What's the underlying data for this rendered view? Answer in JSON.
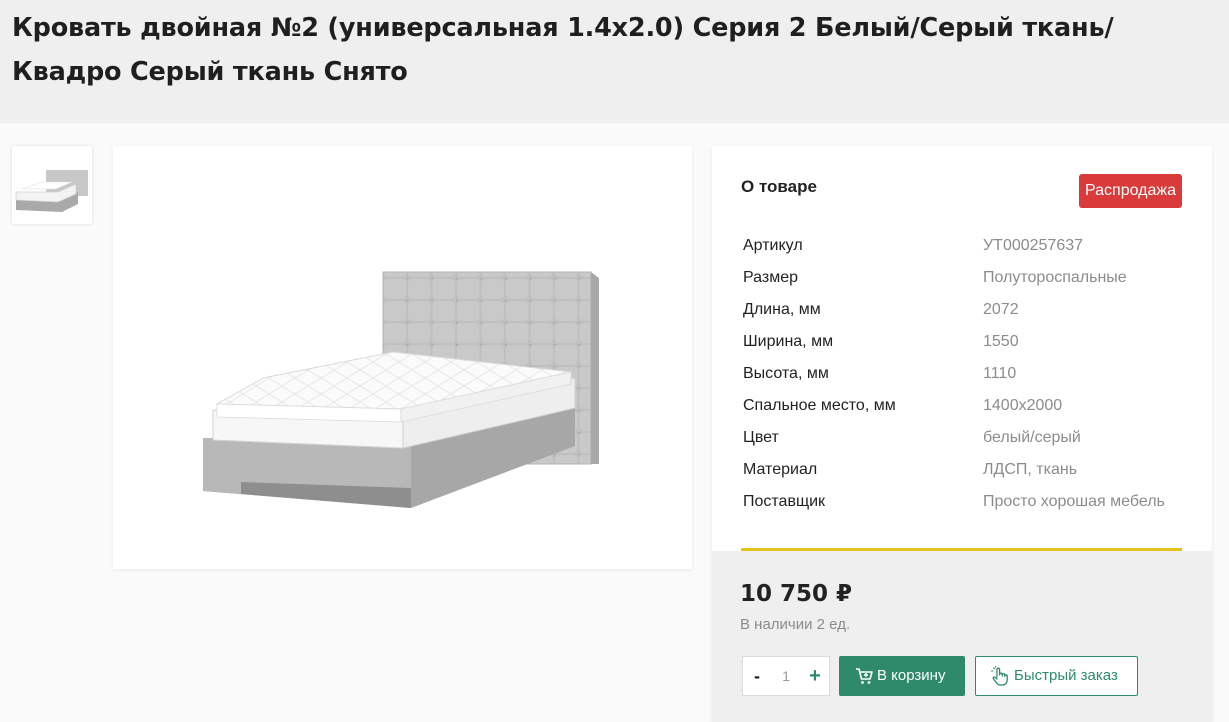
{
  "product": {
    "title": "Кровать двойная №2 (универсальная 1.4х2.0) Серия 2 Белый/Серый ткань/ Квадро Серый ткань Снято"
  },
  "gallery": {
    "thumb_icon": "bed-thumbnail-image",
    "main_icon": "bed-product-image"
  },
  "info": {
    "heading": "О товаре",
    "badge": "Распродажа",
    "badge_color": "#d93a3a",
    "properties": [
      {
        "name": "Артикул",
        "value": "УТ000257637"
      },
      {
        "name": "Размер",
        "value": "Полутороспальные"
      },
      {
        "name": "Длина, мм",
        "value": "2072"
      },
      {
        "name": "Ширина, мм",
        "value": "1550"
      },
      {
        "name": "Высота, мм",
        "value": "1110"
      },
      {
        "name": "Спальное место, мм",
        "value": "1400x2000"
      },
      {
        "name": "Цвет",
        "value": "белый/серый"
      },
      {
        "name": "Материал",
        "value": "ЛДСП, ткань"
      },
      {
        "name": "Поставщик",
        "value": "Просто хорошая мебель"
      }
    ],
    "divider_color": "#e6c21d"
  },
  "purchase": {
    "price": "10 750 ₽",
    "stock": "В наличии 2 ед.",
    "qty_minus": "-",
    "qty_value": "1",
    "qty_plus": "+",
    "cart_label": "В корзину",
    "cart_icon": "cart-plus-icon",
    "quick_label": "Быстрый заказ",
    "quick_icon": "hand-pointer-icon",
    "accent_color": "#2e8a6b"
  }
}
